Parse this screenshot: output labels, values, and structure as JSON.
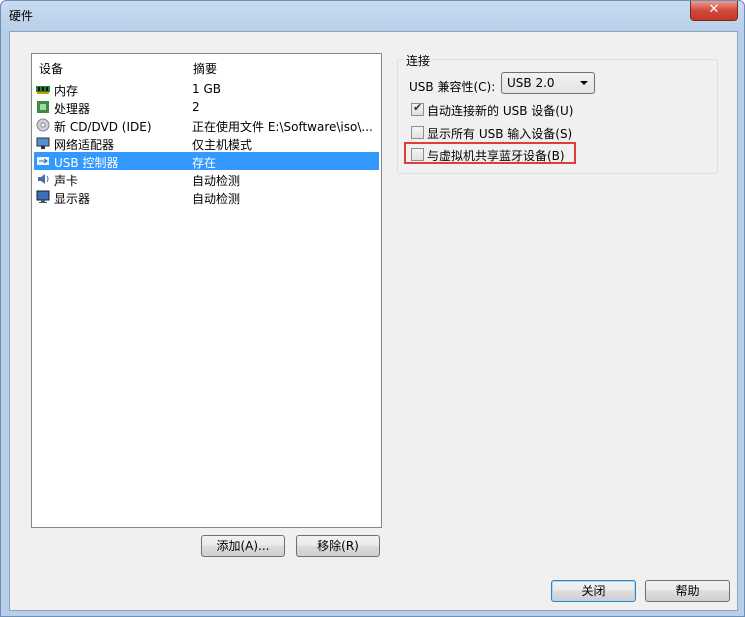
{
  "window": {
    "title": "硬件",
    "close": "✕"
  },
  "hardware_list": {
    "columns": [
      "设备",
      "摘要"
    ],
    "rows": [
      {
        "name": "内存",
        "summary": "1 GB",
        "icon": "memory-icon",
        "selected": false
      },
      {
        "name": "处理器",
        "summary": "2",
        "icon": "processor-icon",
        "selected": false
      },
      {
        "name": "新 CD/DVD (IDE)",
        "summary": "正在使用文件 E:\\Software\\iso\\...",
        "icon": "cd-dvd-icon",
        "selected": false
      },
      {
        "name": "网络适配器",
        "summary": "仅主机模式",
        "icon": "network-adapter-icon",
        "selected": false
      },
      {
        "name": "USB 控制器",
        "summary": "存在",
        "icon": "usb-icon",
        "selected": true
      },
      {
        "name": "声卡",
        "summary": "自动检测",
        "icon": "sound-card-icon",
        "selected": false
      },
      {
        "name": "显示器",
        "summary": "自动检测",
        "icon": "display-icon",
        "selected": false
      }
    ]
  },
  "buttons": {
    "add": "添加(A)...",
    "remove": "移除(R)",
    "close": "关闭",
    "help": "帮助"
  },
  "connection": {
    "group_label": "连接",
    "compat_label": "USB 兼容性(C):",
    "compat_value": "USB 2.0",
    "options": [
      {
        "label": "自动连接新的 USB 设备(U)",
        "checked": true
      },
      {
        "label": "显示所有 USB 输入设备(S)",
        "checked": false
      },
      {
        "label": "与虚拟机共享蓝牙设备(B)",
        "checked": false
      }
    ]
  },
  "colors": {
    "selection": "#3399ff",
    "highlight_box": "#e03c3c"
  }
}
